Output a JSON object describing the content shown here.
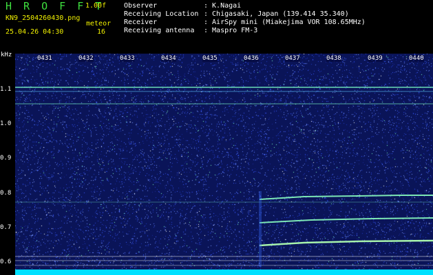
{
  "header": {
    "app_title": "H R O F F T",
    "version": "1.00f",
    "filename": "KN9_2504260430.png",
    "meteor_label": "meteor",
    "timestamp": "25.04.26 04:30",
    "count": "16",
    "info_rows": [
      {
        "label": "Observer",
        "value": ": K.Nagai"
      },
      {
        "label": "Receiving Location",
        "value": ": Chigasaki, Japan (139.414 35.340)"
      },
      {
        "label": "Receiver",
        "value": ": AirSpy mini (Miakejima VOR 108.65MHz)"
      },
      {
        "label": "Receiving antenna",
        "value": ": Maspro FM-3"
      }
    ]
  },
  "spectrogram": {
    "y_unit": "kHz",
    "y_ticks": [
      "1.1",
      "1.0",
      "0.9",
      "0.8",
      "0.7",
      "0.6"
    ],
    "x_ticks": [
      "0431",
      "0432",
      "0433",
      "0434",
      "0435",
      "0436",
      "0437",
      "0438",
      "0439",
      "0440"
    ],
    "colors": {
      "background": "#0a1458",
      "noise": "#3a5cff",
      "line": "#7dffc8",
      "footer": "#00e0ff"
    }
  }
}
